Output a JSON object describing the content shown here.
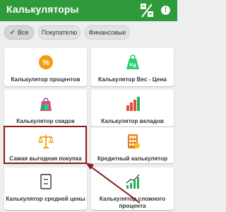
{
  "appbar": {
    "title": "Калькуляторы",
    "icons": [
      "calculator-toggle-icon",
      "info-icon"
    ],
    "info_glyph": "!"
  },
  "filters": {
    "check_glyph": "✓",
    "chips": [
      {
        "label": "Все",
        "selected": true
      },
      {
        "label": "Покупателю",
        "selected": false
      },
      {
        "label": "Финансовые",
        "selected": false
      }
    ]
  },
  "calculators": [
    {
      "label": "Калькулятор процентов",
      "icon": "percent-icon"
    },
    {
      "label": "Калькулятор Вес - Цена",
      "icon": "weight-icon"
    },
    {
      "label": "Калькулятор скидок",
      "icon": "discount-bag-icon"
    },
    {
      "label": "Калькулятор вкладов",
      "icon": "bar-chart-icon"
    },
    {
      "label": "Самая выгодная покупка",
      "icon": "scales-icon"
    },
    {
      "label": "Кредитный калькулятор",
      "icon": "credit-calculator-icon"
    },
    {
      "label": "Калькулятор средней цены",
      "icon": "average-price-icon"
    },
    {
      "label": "Калькулятор сложного процента",
      "icon": "growth-chart-icon"
    }
  ],
  "colors": {
    "appbar": "#2e9a3a",
    "highlight": "#8b1a1a",
    "percent": "#f39c12",
    "weight": "#2ecc71",
    "chart_red": "#e74c3c",
    "chart_green": "#27ae60"
  }
}
